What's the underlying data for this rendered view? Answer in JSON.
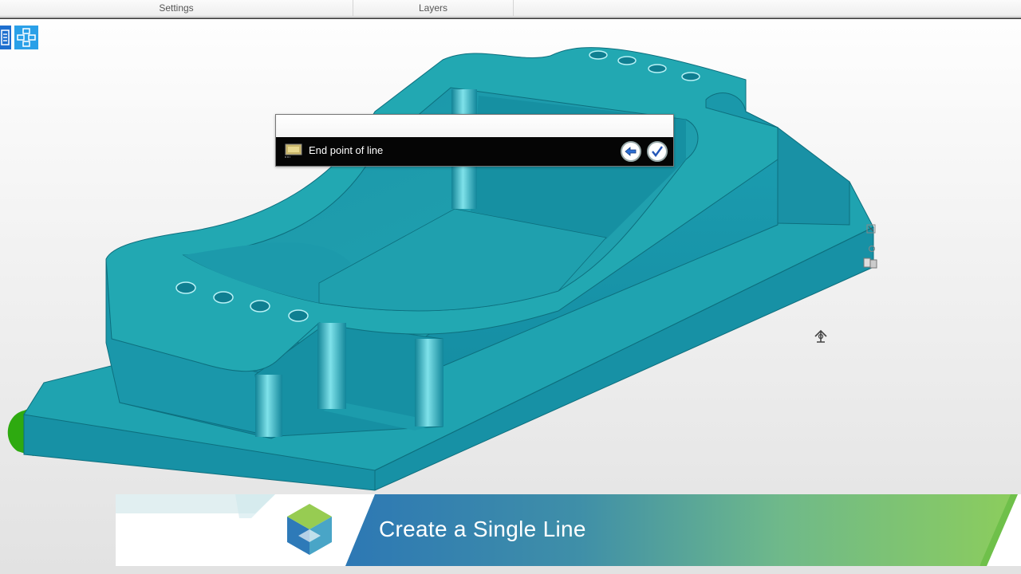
{
  "top_tabs": {
    "settings": "Settings",
    "layers": "Layers"
  },
  "prompt": {
    "text": "End point of line",
    "back_icon": "back-arrow-icon",
    "ok_icon": "checkmark-icon"
  },
  "banner": {
    "title": "Create a Single Line",
    "logo_icon": "hexagon-logo-icon"
  },
  "colors": {
    "model_top": "#21a7ae",
    "model_side": "#1892a4",
    "model_dark": "#0e7d8c",
    "banner_blue": "#2f7fb6",
    "banner_green": "#8ccc5a",
    "highlight_green": "#2eaa10"
  }
}
